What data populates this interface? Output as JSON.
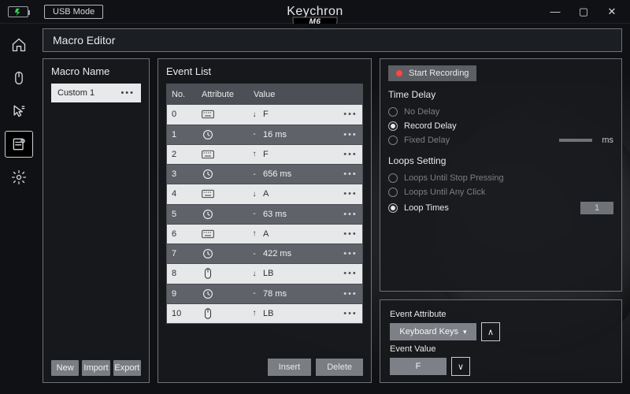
{
  "titlebar": {
    "usb": "USB Mode",
    "brand": "Keychron",
    "product": "M6"
  },
  "header": {
    "title": "Macro Editor"
  },
  "macro": {
    "panel_title": "Macro Name",
    "items": [
      {
        "name": "Custom 1"
      }
    ],
    "btn_new": "New",
    "btn_import": "Import",
    "btn_export": "Export"
  },
  "events": {
    "panel_title": "Event List",
    "th_no": "No.",
    "th_attr": "Attribute",
    "th_val": "Value",
    "rows": [
      {
        "no": "0",
        "attr": "keyboard",
        "dir": "↓",
        "val": "F"
      },
      {
        "no": "1",
        "attr": "clock",
        "dir": "-",
        "val": "16 ms"
      },
      {
        "no": "2",
        "attr": "keyboard",
        "dir": "↑",
        "val": "F"
      },
      {
        "no": "3",
        "attr": "clock",
        "dir": "-",
        "val": "656 ms"
      },
      {
        "no": "4",
        "attr": "keyboard",
        "dir": "↓",
        "val": "A"
      },
      {
        "no": "5",
        "attr": "clock",
        "dir": "-",
        "val": "63 ms"
      },
      {
        "no": "6",
        "attr": "keyboard",
        "dir": "↑",
        "val": "A"
      },
      {
        "no": "7",
        "attr": "clock",
        "dir": "-",
        "val": "422 ms"
      },
      {
        "no": "8",
        "attr": "mouse",
        "dir": "↓",
        "val": "LB"
      },
      {
        "no": "9",
        "attr": "clock",
        "dir": "-",
        "val": "78 ms"
      },
      {
        "no": "10",
        "attr": "mouse",
        "dir": "↑",
        "val": "LB"
      }
    ],
    "btn_insert": "Insert",
    "btn_delete": "Delete"
  },
  "rec": {
    "start": "Start Recording",
    "time_delay_title": "Time Delay",
    "no_delay": "No Delay",
    "record_delay": "Record Delay",
    "fixed_delay": "Fixed Delay",
    "fixed_delay_unit": "ms",
    "loops_title": "Loops Setting",
    "loops_stop": "Loops Until Stop Pressing",
    "loops_click": "Loops Until Any Click",
    "loop_times": "Loop Times",
    "loop_times_val": "1"
  },
  "attr": {
    "attr_label": "Event Attribute",
    "attr_val": "Keyboard Keys",
    "value_label": "Event Value",
    "value_val": "F",
    "up": "∧",
    "down": "∨"
  }
}
